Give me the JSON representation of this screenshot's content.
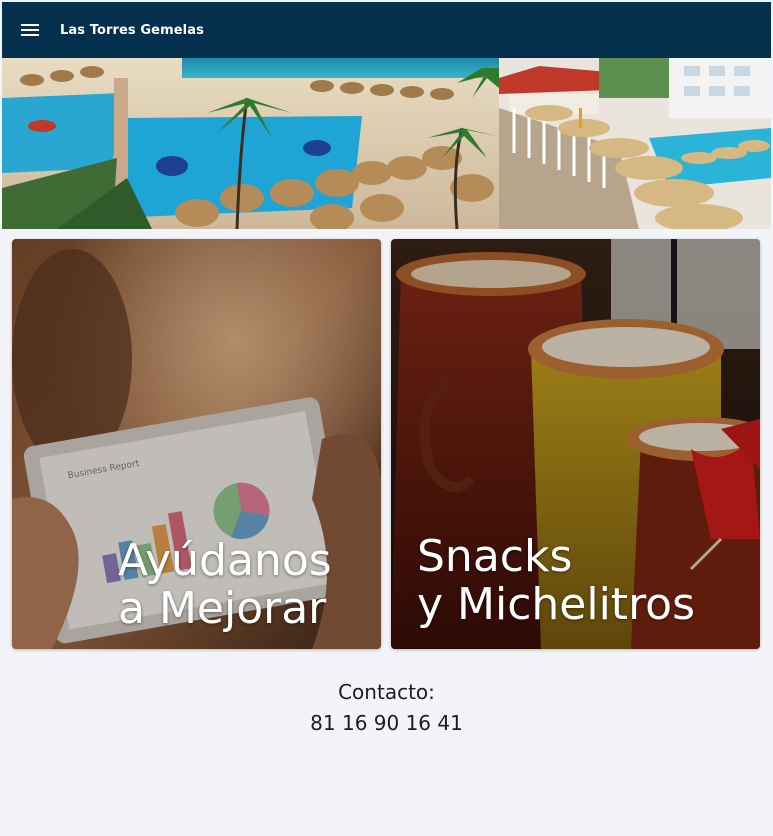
{
  "appbar": {
    "title": "Las Torres Gemelas",
    "menu_icon": "menu-icon",
    "background": "#04304d"
  },
  "banner": {
    "images": [
      "pool-beach-photo",
      "pool-palapas-photo"
    ]
  },
  "cards": [
    {
      "line1": "Ayúdanos",
      "line2": "a Mejorar",
      "image": "tablet-business-report-photo"
    },
    {
      "line1": "Snacks",
      "line2": "y Michelitros",
      "image": "michelada-mugs-photo"
    }
  ],
  "contact": {
    "label": "Contacto:",
    "phone": "81 16 90 16 41"
  }
}
